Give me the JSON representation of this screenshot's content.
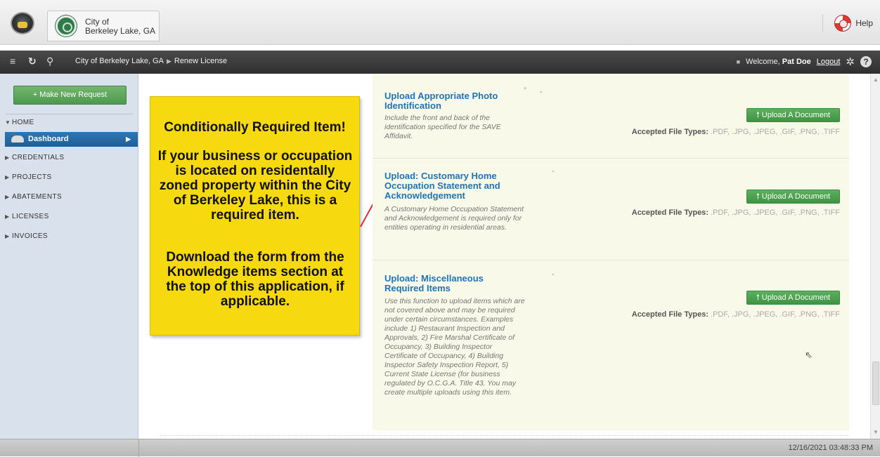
{
  "header": {
    "city_name": "City of\nBerkeley Lake, GA",
    "help_label": "Help"
  },
  "navbar": {
    "breadcrumb": [
      "City of Berkeley Lake, GA",
      "Renew License"
    ],
    "welcome_prefix": "Welcome,",
    "user_name": "Pat Doe",
    "logout_label": "Logout"
  },
  "sidebar": {
    "new_request_label": "+ Make New Request",
    "items": [
      {
        "label": "HOME",
        "expanded": true
      },
      {
        "label": "Dashboard",
        "active": true
      },
      {
        "label": "CREDENTIALS"
      },
      {
        "label": "PROJECTS"
      },
      {
        "label": "ABATEMENTS"
      },
      {
        "label": "LICENSES"
      },
      {
        "label": "INVOICES"
      }
    ]
  },
  "callout": {
    "title": "Conditionally Required Item!",
    "body": "If your business or occupation is located on residentally zoned property within the City of Berkeley Lake, this is a required item.",
    "body2": "Download the form from the Knowledge items section at the top of this application, if applicable."
  },
  "uploads": [
    {
      "title": "Upload Appropriate Photo Identification",
      "required_star": "*",
      "dash": "-",
      "description": "Include the front and back of the identification specified for the SAVE Affidavit.",
      "button_label": "Upload A Document",
      "types_label": "Accepted File Types:",
      "types": ".PDF, .JPG, .JPEG, .GIF, .PNG, .TIFF"
    },
    {
      "title": "Upload: Customary Home Occupation Statement and Acknowledgement",
      "dash": "-",
      "description": "A Customary Home Occupation Statement and Acknowledgement is required only for entities operating in residential areas.",
      "button_label": "Upload A Document",
      "types_label": "Accepted File Types:",
      "types": ".PDF, .JPG, .JPEG, .GIF, .PNG, .TIFF"
    },
    {
      "title": "Upload: Miscellaneous Required Items",
      "dash": "-",
      "description": "Use this function to upload items which are not covered above and may be required under certain circumstances. Examples include 1) Restaurant Inspection and Approvals, 2) Fire Marshal Certificate of Occupancy, 3) Building Inspector Certificate of Occupancy, 4) Building Inspector Safety Inspection Report, 5) Current State License (for business regulated by O.C.G.A. Title 43. You may create multiple uploads using this item.",
      "button_label": "Upload A Document",
      "types_label": "Accepted File Types:",
      "types": ".PDF, .JPG, .JPEG, .GIF, .PNG, .TIFF"
    }
  ],
  "status": {
    "timestamp": "12/16/2021 03:48:33 PM"
  },
  "colors": {
    "link_blue": "#1d74b8",
    "upload_green": "#4c9a4d",
    "callout_yellow": "#f6d90e",
    "panel_bg": "#f8f9e9",
    "sidebar_bg": "#d8e1ec",
    "active_blue": "#1d5e97"
  },
  "icons": [
    "app-logo-icon",
    "city-seal-icon",
    "lifebuoy-icon",
    "menu-icon",
    "refresh-icon",
    "link-icon",
    "lock-icon",
    "gear-icon",
    "help-circle-icon",
    "car-icon",
    "upload-arrow-icon",
    "mouse-cursor-icon"
  ]
}
